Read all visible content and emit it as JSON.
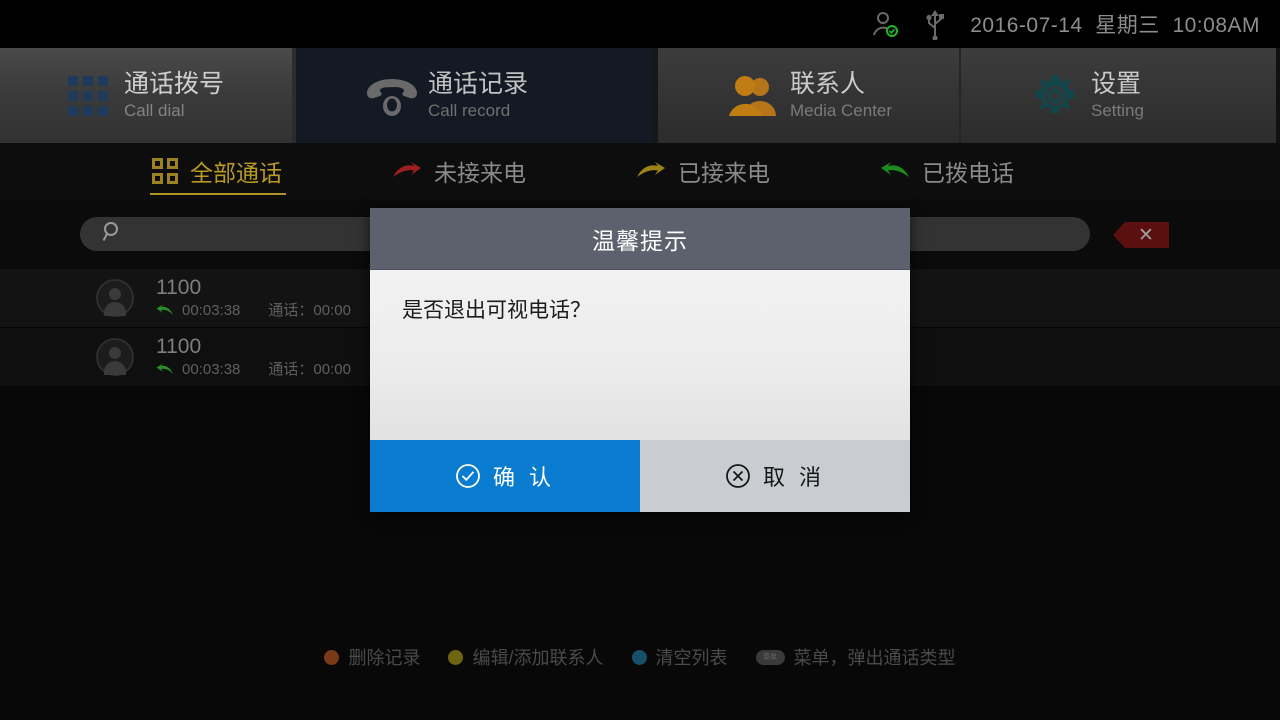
{
  "statusbar": {
    "datetime": "2016-07-14  星期三  10:08AM",
    "icons": [
      "user-online-icon",
      "usb-icon"
    ]
  },
  "nav": {
    "tabs": [
      {
        "id": "call-dial",
        "cn": "通话拨号",
        "en": "Call dial",
        "icon": "dial-grid-icon",
        "active": false
      },
      {
        "id": "call-record",
        "cn": "通话记录",
        "en": "Call record",
        "icon": "telephone-icon",
        "active": true
      },
      {
        "id": "contacts",
        "cn": "联系人",
        "en": "Media Center",
        "icon": "contacts-icon",
        "active": false
      },
      {
        "id": "setting",
        "cn": "设置",
        "en": "Setting",
        "icon": "gear-icon",
        "active": false
      }
    ]
  },
  "filters": {
    "tabs": [
      {
        "id": "all",
        "label": "全部通话",
        "icon": "grid-quad-icon",
        "color": "#b89a24",
        "active": true
      },
      {
        "id": "missed",
        "label": "未接来电",
        "icon": "arrow-missed-icon",
        "color": "#9d1f1f",
        "active": false
      },
      {
        "id": "received",
        "label": "已接来电",
        "icon": "arrow-received-icon",
        "color": "#9c8318",
        "active": false
      },
      {
        "id": "dialed",
        "label": "已拨电话",
        "icon": "arrow-dialed-icon",
        "color": "#1d8a1d",
        "active": false
      }
    ]
  },
  "search": {
    "placeholder": "",
    "value": "",
    "icon": "search-icon"
  },
  "close_button": {
    "label": "✕",
    "icon": "close-icon"
  },
  "call_list": {
    "rows": [
      {
        "number": "1100",
        "direction": "dialed",
        "time": "00:03:38",
        "duration_label": "通话：",
        "duration": "00:00"
      },
      {
        "number": "1100",
        "direction": "dialed",
        "time": "00:03:38",
        "duration_label": "通话：",
        "duration": "00:00"
      }
    ]
  },
  "legend": {
    "items": [
      {
        "label": "删除记录",
        "marker": "dot",
        "color": "#7a3a18"
      },
      {
        "label": "编辑/添加联系人",
        "marker": "dot",
        "color": "#6f6412"
      },
      {
        "label": "清空列表",
        "marker": "dot",
        "color": "#17506b"
      },
      {
        "label": "菜单，弹出通话类型",
        "marker": "pill",
        "color": "#3a3a3a",
        "pill_text": "菜单"
      }
    ]
  },
  "dialog": {
    "title": "温馨提示",
    "message": "是否退出可视电话？",
    "confirm_label": "确 认",
    "cancel_label": "取 消",
    "confirm_icon": "check-circle-icon",
    "cancel_icon": "x-circle-icon",
    "confirm_color": "#0a7cd0",
    "cancel_color": "#c9cdd2",
    "header_color": "#5d616e"
  }
}
